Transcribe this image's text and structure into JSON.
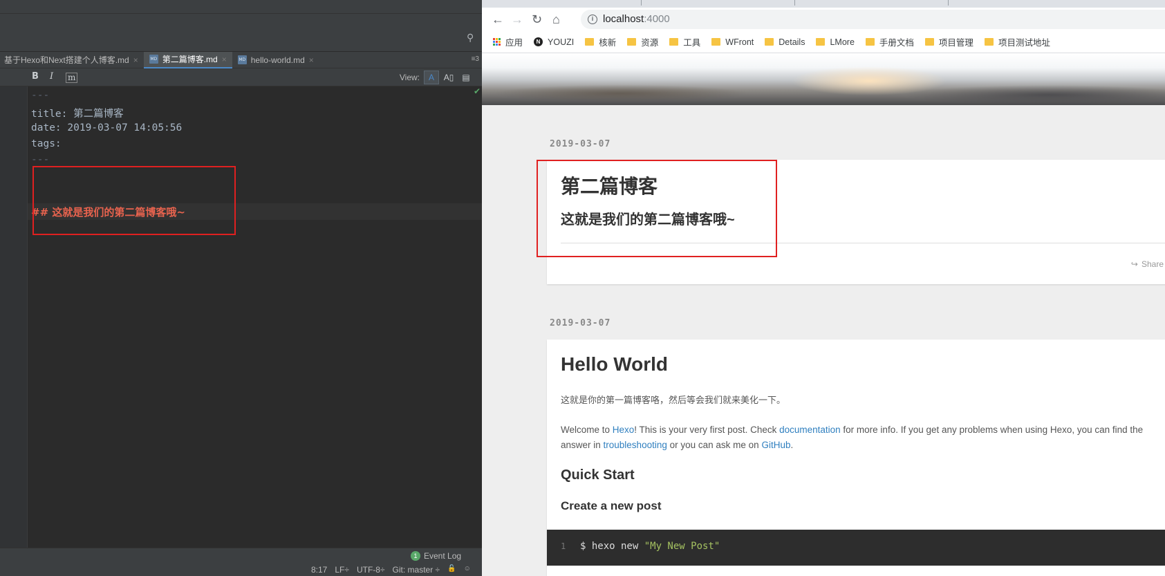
{
  "ide": {
    "tabs": [
      {
        "label": "基于Hexo和Next搭建个人博客.md",
        "close": "×"
      },
      {
        "label": "第二篇博客.md",
        "close": "×"
      },
      {
        "label": "hello-world.md",
        "close": "×"
      }
    ],
    "tab_overflow": "≡3",
    "md_icon_text": "MD",
    "toolbar": {
      "bold": "B",
      "italic": "I",
      "code": "m",
      "view_label": "View:",
      "view_modes": [
        "A",
        "A▯",
        "▤"
      ]
    },
    "code_lines": [
      "---",
      "title: 第二篇博客",
      "date: 2019-03-07 14:05:56",
      "tags:",
      "---",
      "## 这就是我们的第二篇博客哦~"
    ],
    "status": {
      "event_badge": "1",
      "event_log": "Event Log",
      "position": "8:17",
      "line_sep": "LF÷",
      "encoding": "UTF-8÷",
      "git": "Git: master ÷",
      "lock": "🔓",
      "inspector": "☺"
    },
    "check_mark": "✔"
  },
  "browser": {
    "nav": {
      "back": "←",
      "forward": "→",
      "reload": "↻",
      "home": "⌂"
    },
    "url_host": "localhost",
    "url_port": ":4000",
    "info": "i",
    "bookmarks": [
      {
        "label": "应用",
        "icon": "apps-icon"
      },
      {
        "label": "YOUZI",
        "icon": "n-icon"
      },
      {
        "label": "核新",
        "icon": "folder-icon"
      },
      {
        "label": "资源",
        "icon": "folder-icon"
      },
      {
        "label": "工具",
        "icon": "folder-icon"
      },
      {
        "label": "WFront",
        "icon": "folder-icon"
      },
      {
        "label": "Details",
        "icon": "folder-icon"
      },
      {
        "label": "LMore",
        "icon": "folder-icon"
      },
      {
        "label": "手册文档",
        "icon": "folder-icon"
      },
      {
        "label": "项目管理",
        "icon": "folder-icon"
      },
      {
        "label": "项目测试地址",
        "icon": "folder-icon"
      }
    ],
    "n_icon_text": "N",
    "posts": [
      {
        "date": "2019-03-07",
        "title": "第二篇博客",
        "subtitle": "这就是我们的第二篇博客哦~",
        "share": "Share",
        "share_icon": "↪"
      },
      {
        "date": "2019-03-07",
        "title": "Hello World",
        "p1": "这就是你的第一篇博客咯，然后等会我们就来美化一下。",
        "p2": {
          "t1": "Welcome to ",
          "l1": "Hexo",
          "t2": "! This is your very first post. Check ",
          "l2": "documentation",
          "t3": " for more info. If you get any problems when using Hexo, you can find the answer in ",
          "l3": "troubleshooting",
          "t4": " or you can ask me on ",
          "l4": "GitHub",
          "t5": "."
        },
        "h2": "Quick Start",
        "h3": "Create a new post",
        "code": {
          "line_no": "1",
          "cmd": "$ hexo new ",
          "arg": "\"My New Post\""
        }
      }
    ]
  },
  "colors": {
    "accent_red": "#e02020",
    "link": "#2f7fbf",
    "ide_bg": "#2b2b2b"
  }
}
